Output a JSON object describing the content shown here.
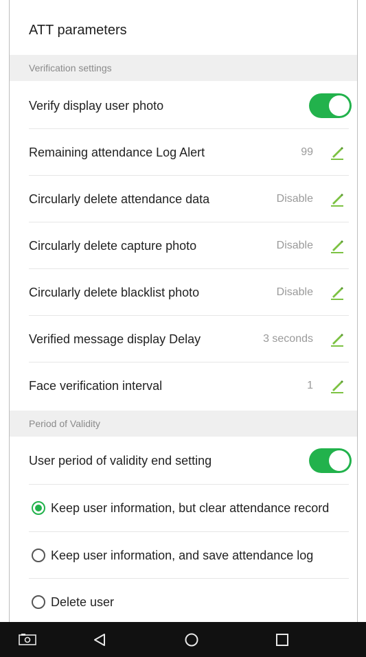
{
  "header": {
    "title": "ATT parameters"
  },
  "sections": {
    "verification": "Verification settings",
    "validity": "Period of Validity"
  },
  "settings": {
    "verify_photo": {
      "label": "Verify display user photo",
      "enabled": true
    },
    "log_alert": {
      "label": "Remaining attendance Log Alert",
      "value": "99"
    },
    "delete_attendance": {
      "label": "Circularly delete attendance data",
      "value": "Disable"
    },
    "delete_capture": {
      "label": "Circularly delete capture photo",
      "value": "Disable"
    },
    "delete_blacklist": {
      "label": "Circularly delete blacklist photo",
      "value": "Disable"
    },
    "message_delay": {
      "label": "Verified message display Delay",
      "value": "3 seconds"
    },
    "face_interval": {
      "label": "Face verification interval",
      "value": "1"
    },
    "validity_end": {
      "label": "User period of validity end setting",
      "enabled": true
    }
  },
  "validity_options": [
    {
      "label": "Keep user information, but clear attendance record",
      "selected": true
    },
    {
      "label": "Keep user information, and save attendance log",
      "selected": false
    },
    {
      "label": "Delete user",
      "selected": false
    }
  ],
  "colors": {
    "accent": "#22b24c",
    "section_bg": "#efefef",
    "navbar_bg": "#111111",
    "edit_icon": "#7cc242"
  },
  "icons": {
    "edit": "pencil-icon",
    "screenshot": "screenshot-icon",
    "back": "back-triangle-icon",
    "home": "home-circle-icon",
    "recents": "recents-square-icon"
  }
}
